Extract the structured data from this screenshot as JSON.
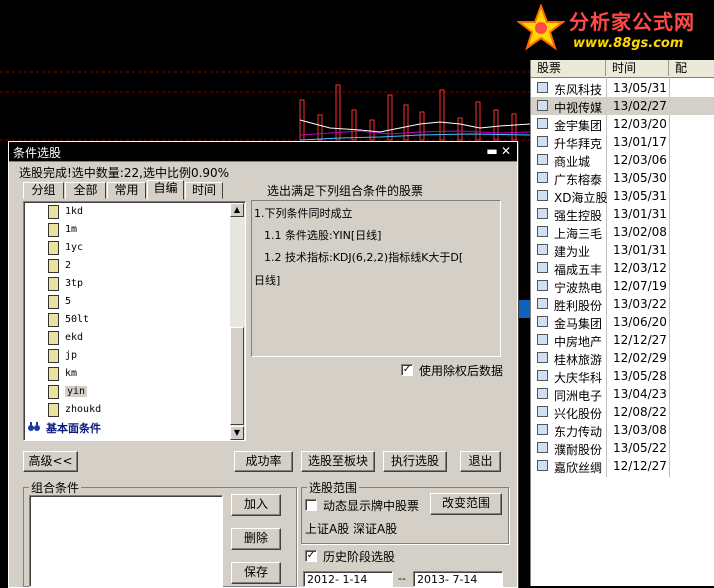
{
  "logo": {
    "title": "分析家公式网",
    "url": "www.88gs.com"
  },
  "stock_list": {
    "headers": [
      "股票",
      "时间",
      "配"
    ],
    "rows": [
      {
        "name": "东风科技",
        "time": "13/05/31"
      },
      {
        "name": "中视传媒",
        "time": "13/02/27"
      },
      {
        "name": "金宇集团",
        "time": "12/03/20"
      },
      {
        "name": "升华拜克",
        "time": "13/01/17"
      },
      {
        "name": "商业城",
        "time": "12/03/06"
      },
      {
        "name": "广东榕泰",
        "time": "13/05/30"
      },
      {
        "name": "XD海立股",
        "time": "13/05/31"
      },
      {
        "name": "强生控股",
        "time": "13/01/31"
      },
      {
        "name": "上海三毛",
        "time": "13/02/08"
      },
      {
        "name": "建为业",
        "time": "13/01/31"
      },
      {
        "name": "福成五丰",
        "time": "12/03/12"
      },
      {
        "name": "宁波热电",
        "time": "12/07/19"
      },
      {
        "name": "胜利股份",
        "time": "13/03/22"
      },
      {
        "name": "金马集团",
        "time": "13/06/20"
      },
      {
        "name": "中房地产",
        "time": "12/12/27"
      },
      {
        "name": "桂林旅游",
        "time": "12/02/29"
      },
      {
        "name": "大庆华科",
        "time": "13/05/28"
      },
      {
        "name": "同洲电子",
        "time": "13/04/23"
      },
      {
        "name": "兴化股份",
        "time": "12/08/22"
      },
      {
        "name": "东力传动",
        "time": "13/03/08"
      },
      {
        "name": "濮耐股份",
        "time": "13/05/22"
      },
      {
        "name": "嘉欣丝绸",
        "time": "12/12/27"
      }
    ],
    "selected_index": 1
  },
  "dialog": {
    "title": "条件选股",
    "status": "选股完成!选中数量:22,选中比例0.90%",
    "tabs": [
      "分组",
      "全部",
      "常用",
      "自编",
      "时间"
    ],
    "active_tab": "自编",
    "tree_items": [
      "1kd",
      "1m",
      "1yc",
      "2",
      "3tp",
      "5",
      "50lt",
      "ekd",
      "jp",
      "km",
      "yin",
      "zhoukd"
    ],
    "tree_selected": "yin",
    "tree_footer": "基本面条件",
    "result_label": "选出满足下列组合条件的股票",
    "result_lines": [
      "1.下列条件同时成立",
      "1.1 条件选股:YIN[日线]",
      "1.2 技术指标:KDJ(6,2,2)指标线K大于D[",
      "日线]"
    ],
    "use_adjusted_label": "使用除权后数据",
    "use_adjusted_checked": true,
    "buttons": {
      "advanced": "高级<<",
      "success_rate": "成功率",
      "to_board": "选股至板块",
      "execute": "执行选股",
      "exit": "退出",
      "add": "加入",
      "delete": "删除",
      "save": "保存",
      "change_range": "改变范围"
    },
    "combo_label": "组合条件",
    "range_group": "选股范围",
    "dynamic_label": "动态显示牌中股票",
    "dynamic_checked": false,
    "range_text": "上证A股 深证A股",
    "history_label": "历史阶段选股",
    "history_checked": true,
    "date_from": "2012- 1-14",
    "date_sep": "--",
    "date_to": "2013- 7-14"
  },
  "colors": {
    "accent_red": "#ff4a4a",
    "logo_yellow": "#ffd800",
    "chart_grid": "#7a0000"
  }
}
